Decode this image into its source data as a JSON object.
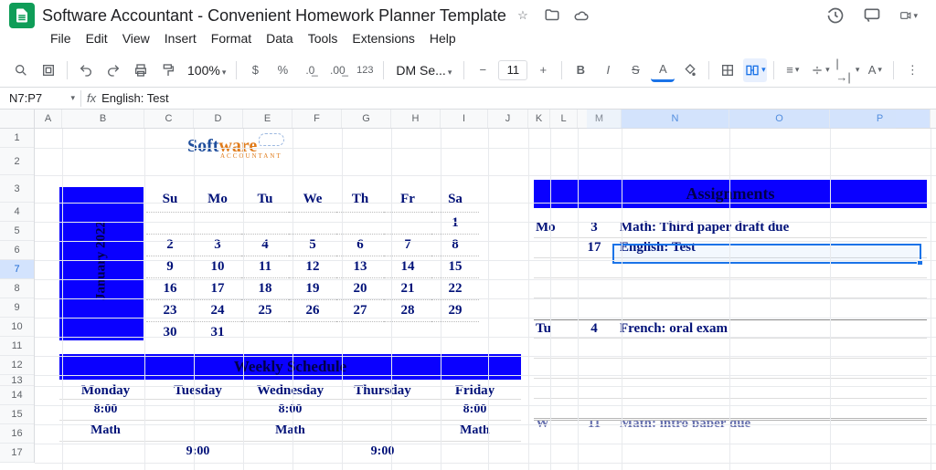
{
  "header": {
    "title": "Software Accountant - Convenient Homework Planner Template"
  },
  "menubar": [
    "File",
    "Edit",
    "View",
    "Insert",
    "Format",
    "Data",
    "Tools",
    "Extensions",
    "Help"
  ],
  "toolbar": {
    "zoom": "100%",
    "font_name": "DM Se...",
    "font_size": "11"
  },
  "namebox": {
    "ref": "N7:P7",
    "fx": "fx",
    "formula": "English: Test"
  },
  "cols": [
    {
      "l": "A",
      "w": 30
    },
    {
      "l": "B",
      "w": 90
    },
    {
      "l": "C",
      "w": 54
    },
    {
      "l": "D",
      "w": 54
    },
    {
      "l": "E",
      "w": 54
    },
    {
      "l": "F",
      "w": 54
    },
    {
      "l": "G",
      "w": 54
    },
    {
      "l": "H",
      "w": 54
    },
    {
      "l": "I",
      "w": 52
    },
    {
      "l": "J",
      "w": 44
    },
    {
      "l": "K",
      "w": 24
    },
    {
      "l": "L",
      "w": 30
    },
    {
      "l": "M",
      "w": 48
    },
    {
      "l": "N",
      "w": 118
    },
    {
      "l": "O",
      "w": 110
    },
    {
      "l": "P",
      "w": 110
    }
  ],
  "rows": [
    "1",
    "2",
    "3",
    "4",
    "5",
    "6",
    "7",
    "8",
    "9",
    "10",
    "11",
    "12",
    "13",
    "14",
    "15",
    "16",
    "17"
  ],
  "selected_cols": [
    "N",
    "O",
    "P"
  ],
  "selected_row": "7",
  "logo": {
    "t1": "Soft",
    "t2": "ware",
    "sub": "ACCOUNTANT"
  },
  "calendar": {
    "month": "January   2022",
    "dh": [
      "Su",
      "Mo",
      "Tu",
      "We",
      "Th",
      "Fr",
      "Sa"
    ],
    "weeks": [
      [
        "",
        "",
        "",
        "",
        "",
        "",
        "1"
      ],
      [
        "2",
        "3",
        "4",
        "5",
        "6",
        "7",
        "8"
      ],
      [
        "9",
        "10",
        "11",
        "12",
        "13",
        "14",
        "15"
      ],
      [
        "16",
        "17",
        "18",
        "19",
        "20",
        "21",
        "22"
      ],
      [
        "23",
        "24",
        "25",
        "26",
        "27",
        "28",
        "29"
      ],
      [
        "30",
        "31",
        "",
        "",
        "",
        "",
        ""
      ]
    ]
  },
  "weekly": {
    "title": "Weekly Schedule",
    "days": [
      "Monday",
      "Tuesday",
      "Wednesday",
      "Thursday",
      "Friday"
    ],
    "r1": [
      "8:00",
      "",
      "8:00",
      "",
      "8:00"
    ],
    "r2": [
      "Math",
      "",
      "Math",
      "",
      "Math"
    ],
    "r3": [
      "",
      "9:00",
      "",
      "9:00",
      ""
    ]
  },
  "assignments": {
    "title": "Assignments",
    "groups": [
      {
        "day": "Mo",
        "items": [
          {
            "d": "3",
            "t": "Math: Third paper draft due"
          },
          {
            "d": "17",
            "t": "English: Test"
          }
        ],
        "blanks": 3
      },
      {
        "day": "Tu",
        "items": [
          {
            "d": "4",
            "t": "French: oral exam"
          }
        ],
        "blanks": 4
      }
    ],
    "cutoff": {
      "day": "W",
      "d": "11",
      "t": "Math: intro paper due"
    }
  }
}
